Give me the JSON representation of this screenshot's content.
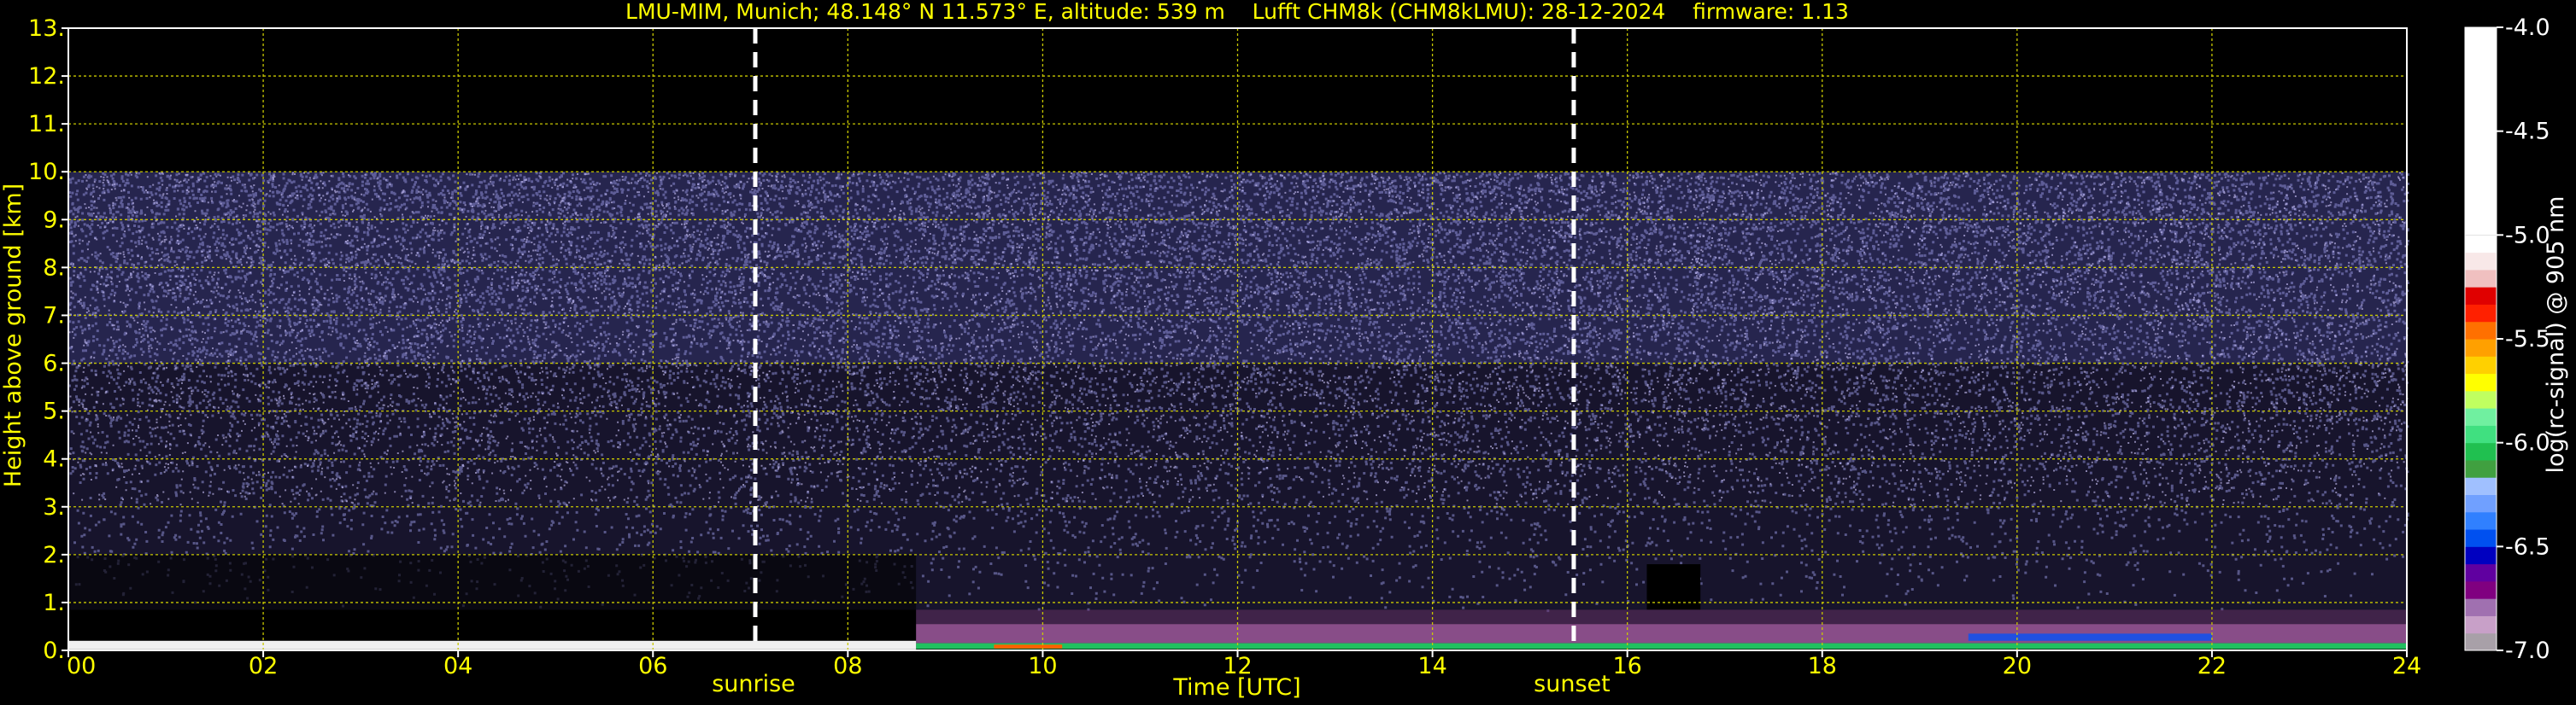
{
  "chart_data": {
    "type": "heatmap",
    "title": "LMU-MIM, Munich; 48.148° N 11.573° E, altitude: 539 m    Lufft CHM8k (CHM8kLMU): 28-12-2024    firmware: 1.13",
    "xlabel": "Time [UTC]",
    "ylabel": "Height above ground [km]",
    "xlim": [
      0,
      24
    ],
    "ylim": [
      0,
      13
    ],
    "x_ticks": [
      0,
      2,
      4,
      6,
      8,
      10,
      12,
      14,
      16,
      18,
      20,
      22,
      24
    ],
    "x_tick_labels": [
      "00",
      "02",
      "04",
      "06",
      "08",
      "10",
      "12",
      "14",
      "16",
      "18",
      "20",
      "22",
      "24"
    ],
    "y_ticks": [
      0,
      1,
      2,
      3,
      4,
      5,
      6,
      7,
      8,
      9,
      10,
      11,
      12,
      13
    ],
    "y_tick_labels": [
      "0.",
      "1.",
      "2.",
      "3.",
      "4.",
      "5.",
      "6.",
      "7.",
      "8.",
      "9.",
      "10.",
      "11.",
      "12.",
      "13."
    ],
    "grid": true,
    "data_top_km": 10,
    "markers": [
      {
        "label": "sunrise",
        "x": 7.05
      },
      {
        "label": "sunset",
        "x": 15.45
      }
    ],
    "features": {
      "surface_layer_top_km": 0.2,
      "boundary_layer_top_km": 0.85,
      "gap_segment": {
        "start": 16.2,
        "end": 16.75,
        "top_km": 0.7
      }
    },
    "colorbar": {
      "label": "log(rc-signal) @ 905 nm",
      "range": [
        -7.0,
        -4.0
      ],
      "ticks": [
        -4.0,
        -4.5,
        -5.0,
        -5.5,
        -6.0,
        -6.5,
        -7.0
      ],
      "tick_labels": [
        "-4.0",
        "-4.5",
        "-5.0",
        "-5.5",
        "-6.0",
        "-6.5",
        "-7.0"
      ],
      "colors": [
        "#a8a0a8",
        "#c8a0c8",
        "#a070b0",
        "#800080",
        "#6000a0",
        "#0000c0",
        "#0050f0",
        "#3080ff",
        "#70a0ff",
        "#a0c0ff",
        "#40a040",
        "#20c050",
        "#40e080",
        "#70f0a0",
        "#c0ff60",
        "#ffff00",
        "#ffd000",
        "#ffa000",
        "#ff7000",
        "#ff2000",
        "#e00000",
        "#f0c0c0",
        "#f8e8e8",
        "#ffffff"
      ]
    }
  }
}
